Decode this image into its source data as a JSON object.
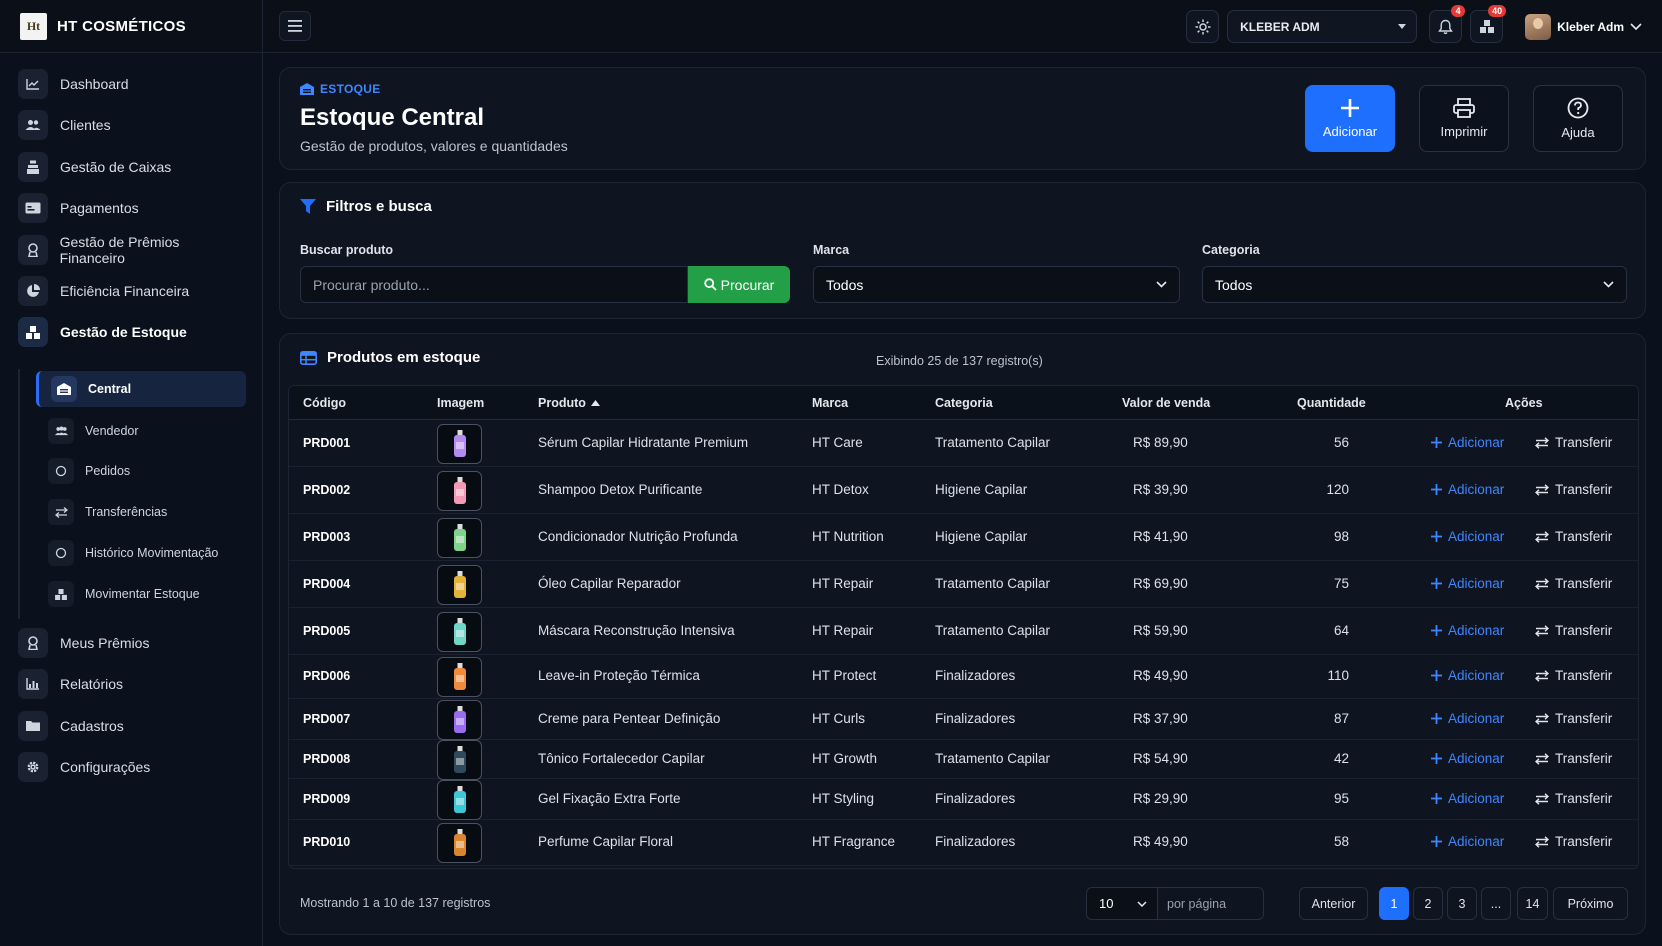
{
  "brand": {
    "logo_text": "Ht",
    "name": "HT COSMÉTICOS"
  },
  "topbar": {
    "company": "KLEBER ADM",
    "notifications_count": "4",
    "inventory_count": "40",
    "user_name": "Kleber Adm"
  },
  "sidebar": {
    "items": [
      {
        "label": "Dashboard",
        "icon": "chart-line-icon"
      },
      {
        "label": "Clientes",
        "icon": "users-icon"
      },
      {
        "label": "Gestão de Caixas",
        "icon": "cash-register-icon"
      },
      {
        "label": "Pagamentos",
        "icon": "credit-card-icon"
      },
      {
        "label": "Gestão de Prêmios Financeiro",
        "icon": "award-icon"
      },
      {
        "label": "Eficiência Financeira",
        "icon": "pie-chart-icon"
      },
      {
        "label": "Gestão de Estoque",
        "icon": "boxes-icon"
      },
      {
        "label": "Meus Prêmios",
        "icon": "award-icon"
      },
      {
        "label": "Relatórios",
        "icon": "bar-chart-icon"
      },
      {
        "label": "Cadastros",
        "icon": "folder-icon"
      },
      {
        "label": "Configurações",
        "icon": "gear-icon"
      }
    ],
    "subitems": [
      {
        "label": "Central",
        "icon": "warehouse-icon"
      },
      {
        "label": "Vendedor",
        "icon": "users-icon"
      },
      {
        "label": "Pedidos",
        "icon": "circle-icon"
      },
      {
        "label": "Transferências",
        "icon": "arrows-icon"
      },
      {
        "label": "Histórico Movimentação",
        "icon": "circle-icon"
      },
      {
        "label": "Movimentar Estoque",
        "icon": "boxes-icon"
      }
    ]
  },
  "header": {
    "breadcrumb": "ESTOQUE",
    "title": "Estoque Central",
    "subtitle": "Gestão de produtos, valores e quantidades",
    "buttons": {
      "add": "Adicionar",
      "print": "Imprimir",
      "help": "Ajuda"
    }
  },
  "filters": {
    "title": "Filtros e busca",
    "search_label": "Buscar produto",
    "search_placeholder": "Procurar produto...",
    "search_button": "Procurar",
    "brand_label": "Marca",
    "brand_value": "Todos",
    "category_label": "Categoria",
    "category_value": "Todos"
  },
  "products": {
    "title": "Produtos em estoque",
    "records_info": "Exibindo 25 de 137 registro(s)",
    "columns": {
      "code": "Código",
      "image": "Imagem",
      "product": "Produto",
      "brand": "Marca",
      "category": "Categoria",
      "price": "Valor de venda",
      "qty": "Quantidade",
      "actions": "Ações"
    },
    "action_add": "Adicionar",
    "action_transfer": "Transferir",
    "rows": [
      {
        "code": "PRD001",
        "product": "Sérum Capilar Hidratante Premium",
        "brand": "HT Care",
        "category": "Tratamento Capilar",
        "price": "R$ 89,90",
        "qty": "56",
        "img_color": "#b48cf0"
      },
      {
        "code": "PRD002",
        "product": "Shampoo Detox Purificante",
        "brand": "HT Detox",
        "category": "Higiene Capilar",
        "price": "R$ 39,90",
        "qty": "120",
        "img_color": "#f29ab8"
      },
      {
        "code": "PRD003",
        "product": "Condicionador Nutrição Profunda",
        "brand": "HT Nutrition",
        "category": "Higiene Capilar",
        "price": "R$ 41,90",
        "qty": "98",
        "img_color": "#7fd48a"
      },
      {
        "code": "PRD004",
        "product": "Óleo Capilar Reparador",
        "brand": "HT Repair",
        "category": "Tratamento Capilar",
        "price": "R$ 69,90",
        "qty": "75",
        "img_color": "#e3b43a"
      },
      {
        "code": "PRD005",
        "product": "Máscara Reconstrução Intensiva",
        "brand": "HT Repair",
        "category": "Tratamento Capilar",
        "price": "R$ 59,90",
        "qty": "64",
        "img_color": "#6fd6c8"
      },
      {
        "code": "PRD006",
        "product": "Leave-in Proteção Térmica",
        "brand": "HT Protect",
        "category": "Finalizadores",
        "price": "R$ 49,90",
        "qty": "110",
        "img_color": "#f08a3c"
      },
      {
        "code": "PRD007",
        "product": "Creme para Pentear Definição",
        "brand": "HT Curls",
        "category": "Finalizadores",
        "price": "R$ 37,90",
        "qty": "87",
        "img_color": "#9b6cf0"
      },
      {
        "code": "PRD008",
        "product": "Tônico Fortalecedor Capilar",
        "brand": "HT Growth",
        "category": "Tratamento Capilar",
        "price": "R$ 54,90",
        "qty": "42",
        "img_color": "#2f4a5a"
      },
      {
        "code": "PRD009",
        "product": "Gel Fixação Extra Forte",
        "brand": "HT Styling",
        "category": "Finalizadores",
        "price": "R$ 29,90",
        "qty": "95",
        "img_color": "#3cc7d6"
      },
      {
        "code": "PRD010",
        "product": "Perfume Capilar Floral",
        "brand": "HT Fragrance",
        "category": "Finalizadores",
        "price": "R$ 49,90",
        "qty": "58",
        "img_color": "#d9862e"
      }
    ]
  },
  "pagination": {
    "showing": "Mostrando 1 a 10 de 137 registros",
    "per_page_value": "10",
    "per_page_label": "por página",
    "prev": "Anterior",
    "pages": [
      "1",
      "2",
      "3",
      "...",
      "14"
    ],
    "next": "Próximo"
  },
  "colors": {
    "accent": "#1f6fff",
    "success": "#23a047",
    "danger": "#e53935"
  }
}
